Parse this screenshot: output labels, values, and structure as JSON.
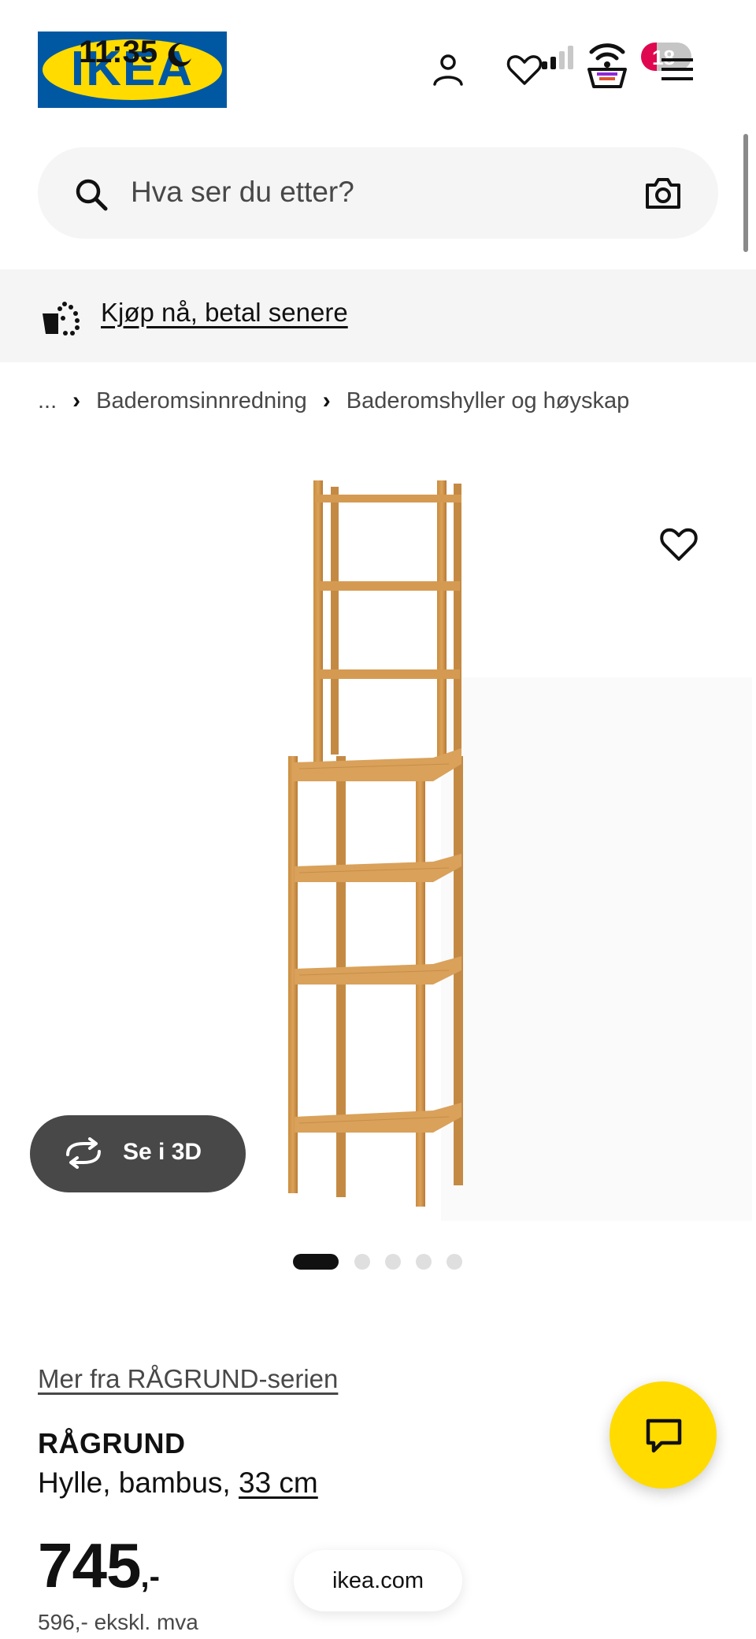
{
  "status_bar": {
    "time": "11:35",
    "notification_count": "18"
  },
  "header": {
    "logo_text": "IKEA",
    "icons": [
      "person-icon",
      "heart-icon",
      "basket-icon",
      "menu-icon"
    ]
  },
  "search": {
    "placeholder": "Hva ser du etter?"
  },
  "promo": {
    "link_text": "Kjøp nå, betal senere"
  },
  "breadcrumb": {
    "ellipsis": "...",
    "items": [
      "Baderomsinnredning",
      "Baderomshyller og høyskap"
    ]
  },
  "gallery": {
    "see_3d_label": "Se i 3D",
    "image_count": 5,
    "active_index": 0
  },
  "product": {
    "series_link": "Mer fra RÅGRUND-serien",
    "name": "RÅGRUND",
    "desc_prefix": "Hylle, bambus, ",
    "size": "33 cm",
    "price_int": "745",
    "price_dec": ",-",
    "price_ex_vat": "596,- ekskl. mva"
  },
  "footer": {
    "domain": "ikea.com"
  },
  "colors": {
    "brand_blue": "#0058a3",
    "brand_yellow": "#ffdb00",
    "badge_red": "#e00751"
  }
}
